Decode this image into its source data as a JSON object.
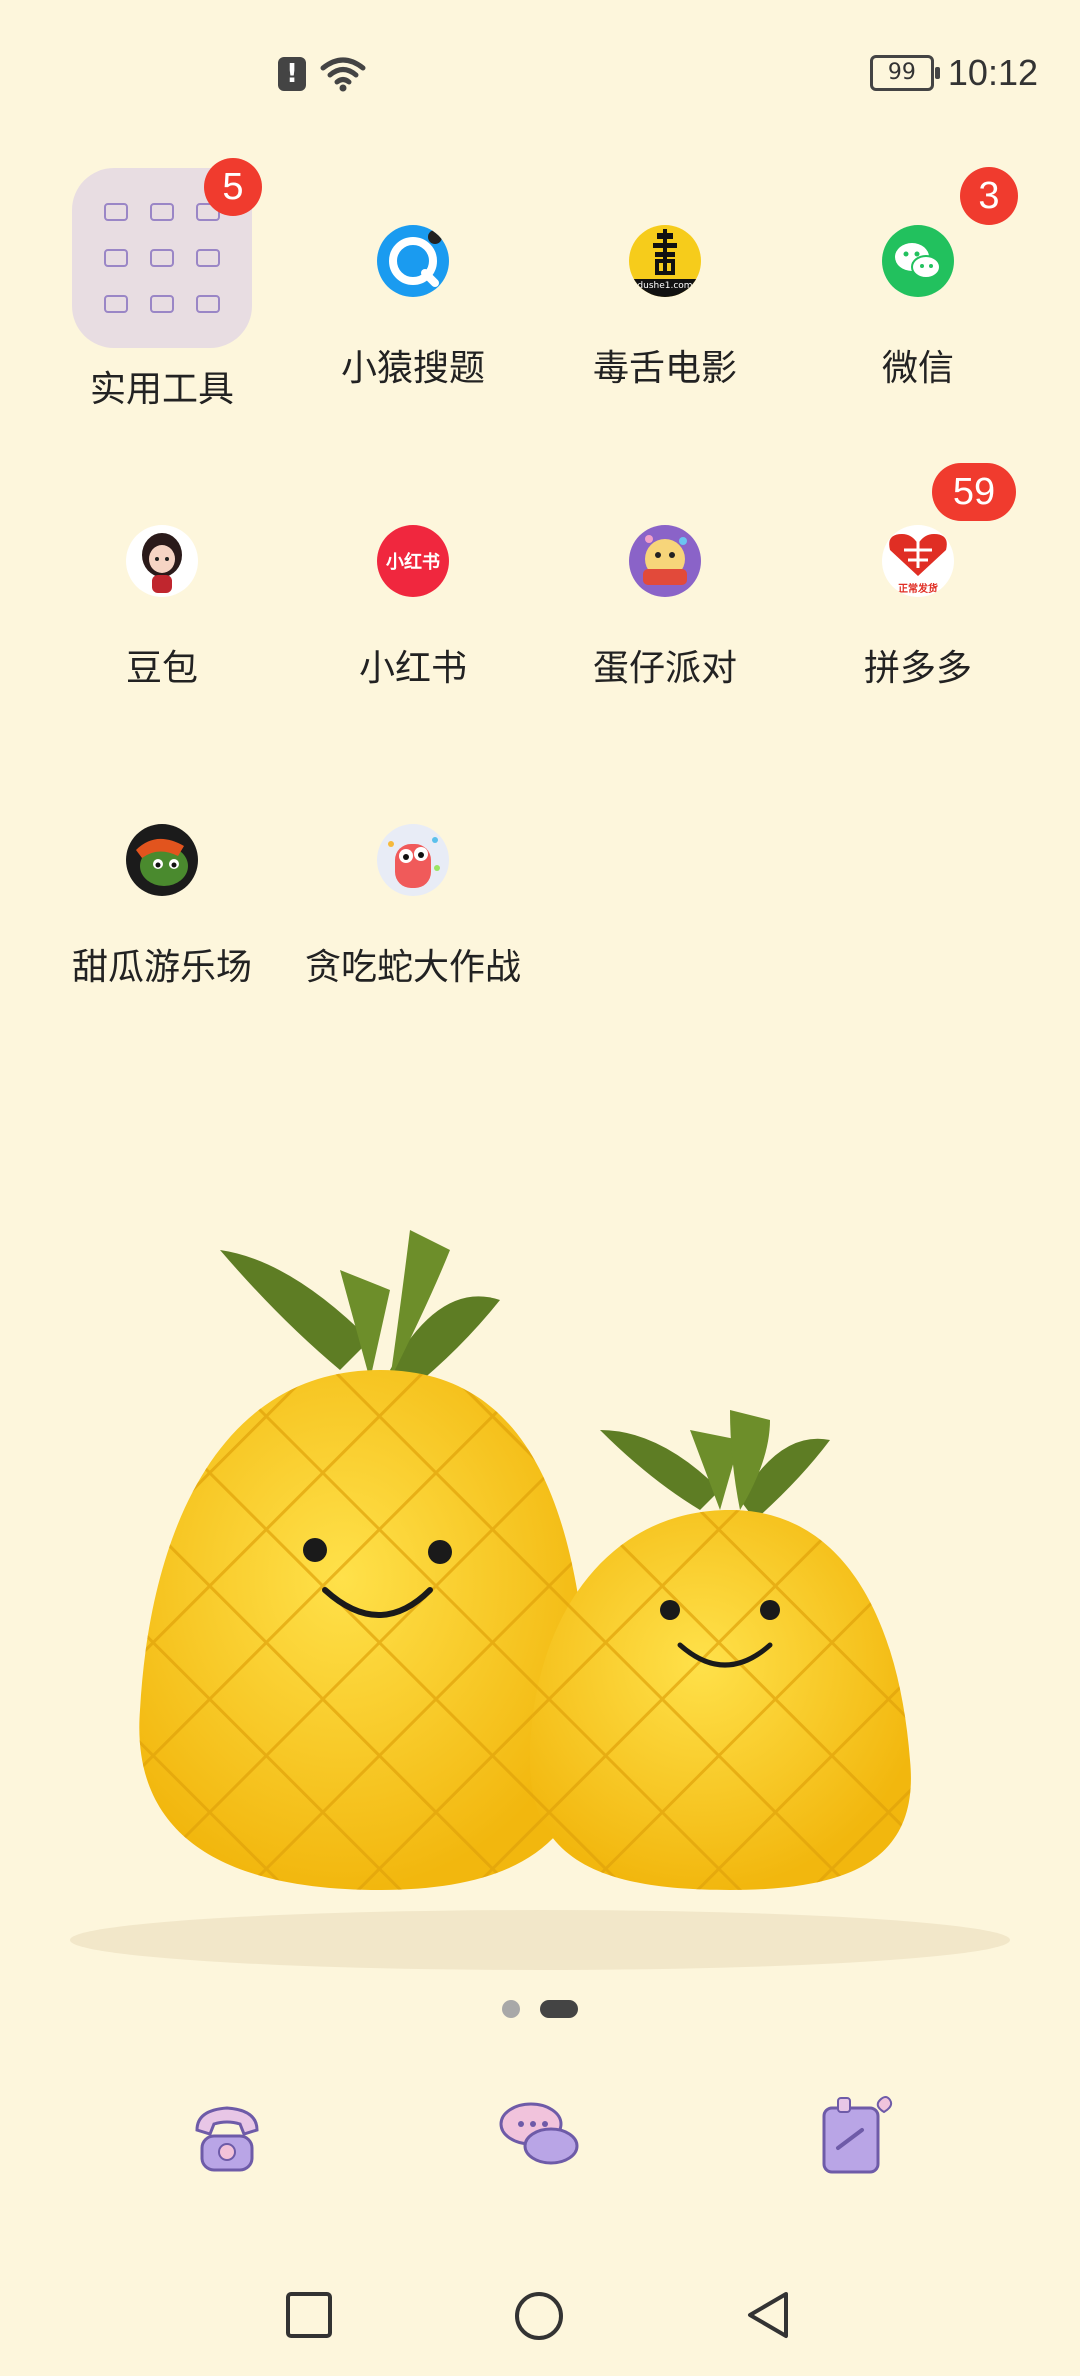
{
  "status_bar": {
    "alert_icon": "!",
    "battery_level": "99",
    "time": "10:12"
  },
  "apps": [
    {
      "label": "实用工具",
      "badge": "5",
      "icon": "folder-icon"
    },
    {
      "label": "小猿搜题",
      "badge": "",
      "icon": "xiaoyuan-icon"
    },
    {
      "label": "毒舌电影",
      "badge": "",
      "icon": "dushe-icon"
    },
    {
      "label": "微信",
      "badge": "3",
      "icon": "wechat-icon"
    },
    {
      "label": "豆包",
      "badge": "",
      "icon": "doubao-icon"
    },
    {
      "label": "小红书",
      "badge": "",
      "icon": "xiaohongshu-icon"
    },
    {
      "label": "蛋仔派对",
      "badge": "",
      "icon": "danzai-icon"
    },
    {
      "label": "拼多多",
      "badge": "59",
      "icon": "pinduoduo-icon"
    },
    {
      "label": "甜瓜游乐场",
      "badge": "",
      "icon": "tiangua-icon"
    },
    {
      "label": "贪吃蛇大作战",
      "badge": "",
      "icon": "snake-icon"
    }
  ],
  "app_icon_text": {
    "dushe": "dushe1.com",
    "xiaohongshu": "小红书",
    "pinduoduo": "正常发货"
  },
  "page_indicator": {
    "count": 2,
    "active": 1
  },
  "dock": [
    "phone-icon",
    "messages-icon",
    "contacts-icon"
  ],
  "colors": {
    "background": "#FDF6DC",
    "badge": "#F03B2E",
    "wechat": "#22C15E",
    "xiaohongshu": "#F0273E",
    "xiaoyuan": "#1A9BF0",
    "dushe": "#F6CC1B",
    "accent_purple": "#9A86C6"
  }
}
